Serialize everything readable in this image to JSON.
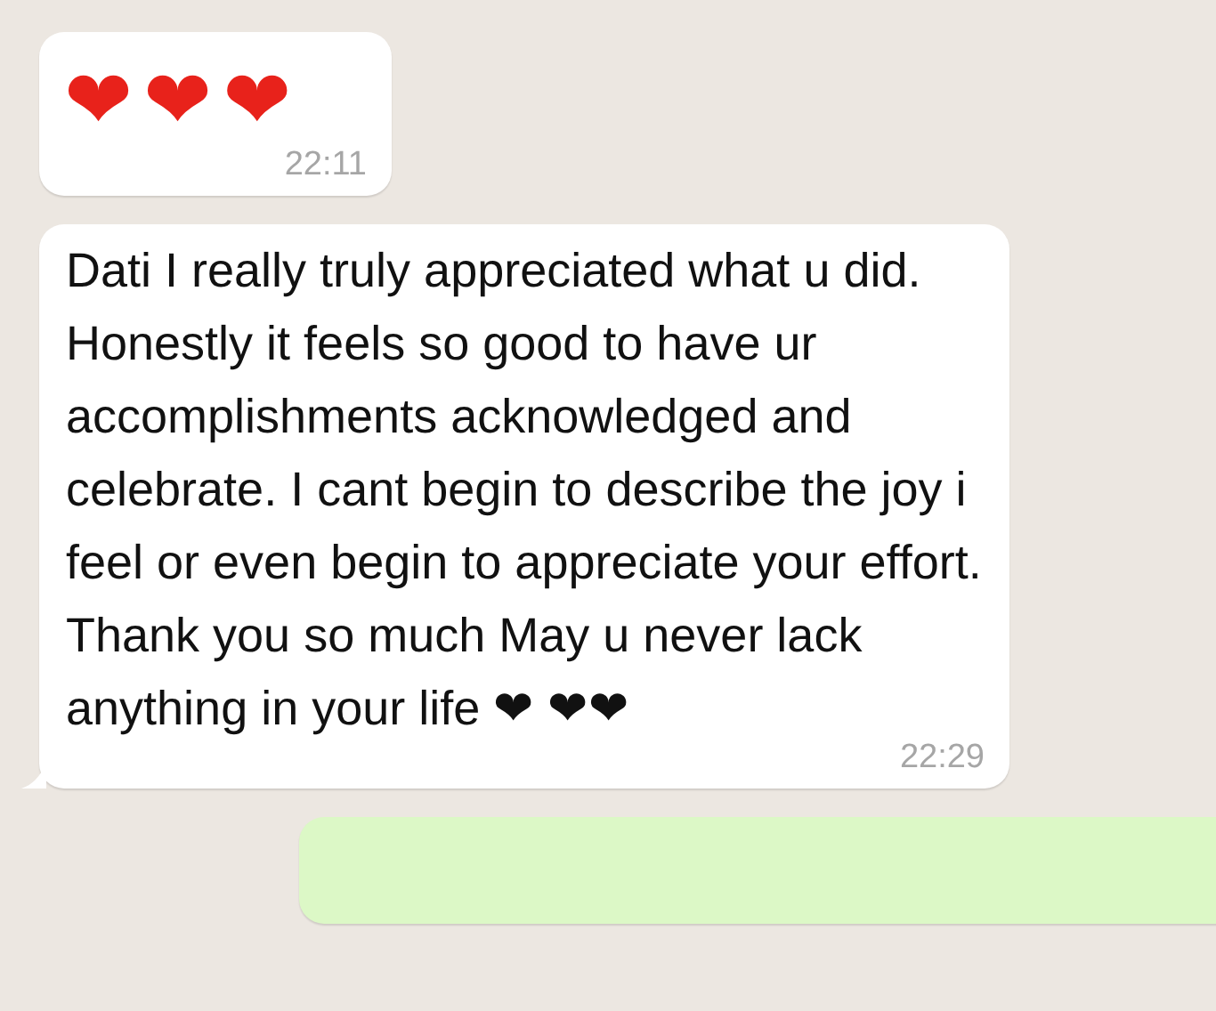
{
  "messages": [
    {
      "kind": "incoming",
      "text": "❤❤❤",
      "time": "22:11",
      "tail": false
    },
    {
      "kind": "incoming",
      "text": "Dati I really truly appreciated what u did. Honestly it feels so good to have ur accomplishments acknowledged and celebrate. I cant begin to describe the joy i feel or even begin to appreciate your effort. Thank you so much May u never lack anything in your life ❤ ❤❤",
      "time": "22:29",
      "tail": true
    },
    {
      "kind": "outgoing",
      "tail": false
    }
  ]
}
